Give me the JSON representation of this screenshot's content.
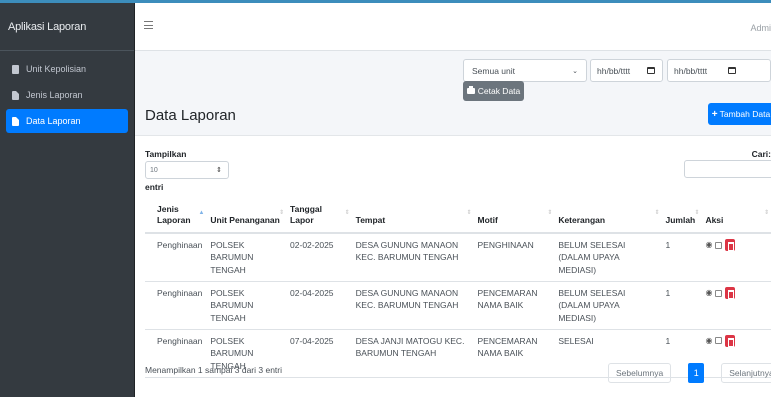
{
  "app": {
    "brand": "Aplikasi Laporan",
    "user": "Admi"
  },
  "sidebar": {
    "items": [
      {
        "label": "Unit Kepolisian",
        "icon": "building-icon"
      },
      {
        "label": "Jenis Laporan",
        "icon": "file-icon"
      },
      {
        "label": "Data Laporan",
        "icon": "file-icon",
        "active": true
      }
    ]
  },
  "filters": {
    "unit_select": "Semua unit",
    "date_from_placeholder": "hh/bb/tttt",
    "date_to_placeholder": "hh/bb/tttt",
    "print_label": "Cetak Data"
  },
  "page": {
    "title": "Data Laporan",
    "add_label": "Tambah Data"
  },
  "table_controls": {
    "show_label": "Tampilkan",
    "length_value": "10",
    "entries_label": "entri",
    "search_label": "Cari:"
  },
  "table": {
    "headers": [
      "Jenis Laporan",
      "Unit Penanganan",
      "Tanggal Lapor",
      "Tempat",
      "Motif",
      "Keterangan",
      "Jumlah",
      "Aksi"
    ],
    "rows": [
      [
        "Penghinaan",
        "POLSEK BARUMUN TENGAH",
        "02-02-2025",
        "DESA GUNUNG MANAON KEC. BARUMUN TENGAH",
        "PENGHINAAN",
        "BELUM SELESAI (DALAM UPAYA MEDIASI)",
        "1"
      ],
      [
        "Penghinaan",
        "POLSEK BARUMUN TENGAH",
        "02-04-2025",
        "DESA GUNUNG MANAON KEC. BARUMUN TENGAH",
        "PENCEMARAN NAMA BAIK",
        "BELUM SELESAI (DALAM UPAYA MEDIASI)",
        "1"
      ],
      [
        "Penghinaan",
        "POLSEK BARUMUN TENGAH",
        "07-04-2025",
        "DESA JANJI MATOGU KEC. BARUMUN TENGAH",
        "PENCEMARAN NAMA BAIK",
        "SELESAI",
        "1"
      ]
    ]
  },
  "footer": {
    "info": "Menampilkan 1 sampai 3 dari 3 entri",
    "prev": "Sebelumnya",
    "page": "1",
    "next": "Selanjutnya"
  },
  "colors": {
    "primary": "#007bff",
    "sidebar": "#343a40",
    "danger": "#dc3545",
    "secondary": "#6c757d"
  }
}
